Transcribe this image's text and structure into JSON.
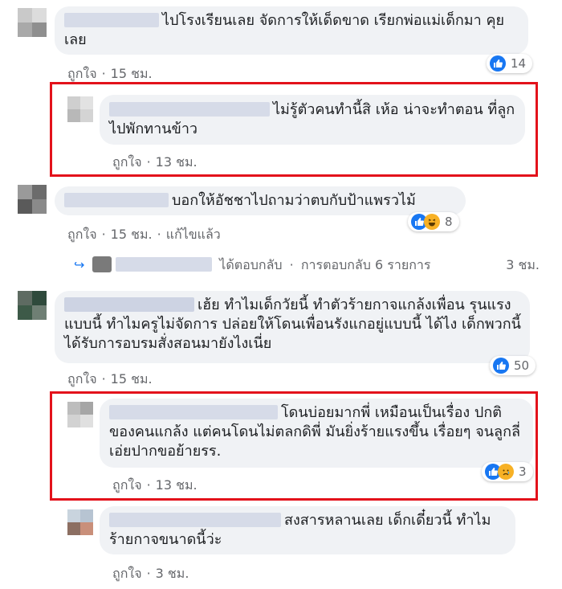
{
  "comments": [
    {
      "text": "ไปโรงเรียนเลย จัดการให้เด็ดขาด เรียกพ่อแม่เด็กมา คุยเลย",
      "like": "ถูกใจ",
      "time": "15 ชม.",
      "reactions": "14"
    },
    {
      "text": "ไม่รู้ตัวคนทำนี้สิ เห้อ น่าจะทำตอน ที่ลูก ไปพักทานข้าว",
      "like": "ถูกใจ",
      "time": "13 ชม."
    },
    {
      "text": "บอกให้อัชชาไปถามว่าตบกับป้าแพรวไม้",
      "like": "ถูกใจ",
      "time": "15 ชม.",
      "edited": "แก้ไขแล้ว",
      "reactions": "8"
    },
    {
      "text": "เฮ้ย ทำไมเด็กวัยนี้ ทำตัวร้ายกาจแกล้งเพื่อน รุนแรงแบบนี้ ทำไมครูไม่จัดการ ปล่อยให้โดนเพื่อนรังแกอยู่แบบนี้ ได้ไง เด็กพวกนี้ได้รับการอบรมสั่งสอนมายังไงเนี่ย",
      "like": "ถูกใจ",
      "time": "15 ชม.",
      "reactions": "50"
    },
    {
      "text": "โดนบ่อยมากพี่ เหมือนเป็นเรื่อง ปกติของคนแกล้ง แต่คนโดนไม่ตลกดิพี่ มันยิ่งร้ายแรงขึ้น เรื่อยๆ จนลูกลี่เอ่ยปากขอย้ายรร.",
      "like": "ถูกใจ",
      "time": "13 ชม.",
      "reactions": "3"
    },
    {
      "text": "สงสารหลานเลย เด็กเดี๋ยวนี้ ทำไมร้ายกาจขนาดนี้ว่ะ",
      "like": "ถูกใจ",
      "time": "3 ชม."
    }
  ],
  "reply_link": {
    "replied": "ได้ตอบกลับ",
    "sep": "·",
    "count_text": "การตอบกลับ 6 รายการ",
    "time": "3 ชม."
  },
  "colors": {
    "highlight": "#e3121b",
    "like": "#1877f2",
    "bubble": "#f0f2f5"
  },
  "icons": [
    "like-icon",
    "haha-icon",
    "sad-icon",
    "reply-arrow-icon"
  ]
}
